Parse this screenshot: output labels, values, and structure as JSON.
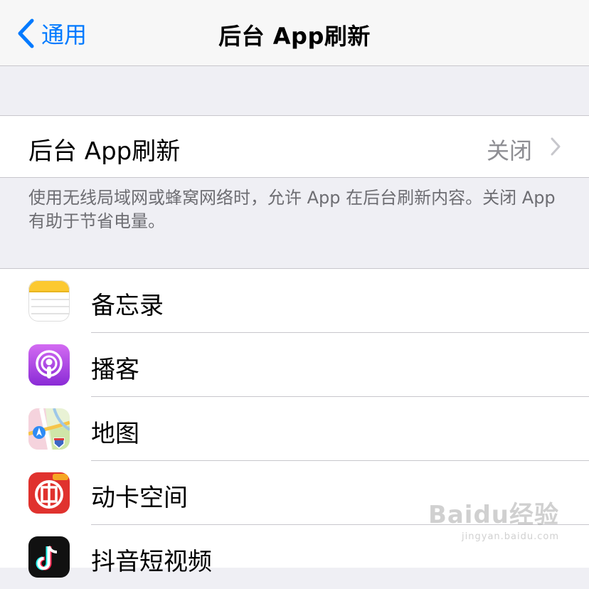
{
  "nav": {
    "back_label": "通用",
    "title": "后台 App刷新"
  },
  "setting": {
    "label": "后台 App刷新",
    "value": "关闭"
  },
  "footer": {
    "text": "使用无线局域网或蜂窝网络时，允许 App 在后台刷新内容。关闭 App 有助于节省电量。"
  },
  "apps": [
    {
      "name": "备忘录",
      "icon": "notes-icon"
    },
    {
      "name": "播客",
      "icon": "podcasts-icon"
    },
    {
      "name": "地图",
      "icon": "maps-icon"
    },
    {
      "name": "动卡空间",
      "icon": "dongka-icon"
    },
    {
      "name": "抖音短视频",
      "icon": "douyin-icon"
    }
  ],
  "watermark": {
    "brand": "Baidu经验",
    "url": "jingyan.baidu.com"
  },
  "colors": {
    "accent": "#007aff",
    "background": "#efeff4",
    "secondary_text": "#8e8e93"
  }
}
